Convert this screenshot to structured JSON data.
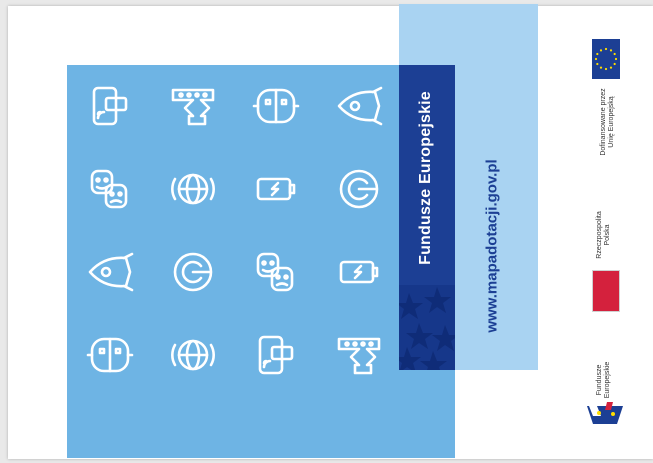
{
  "panel": {
    "title": "Fundusze Europejskie",
    "url": "www.mapadotacji.gov.pl"
  },
  "side": {
    "eu_label_line1": "Dofinansowane przez",
    "eu_label_line2": "Unię Europejską",
    "pl_label_line1": "Rzeczpospolita",
    "pl_label_line2": "Polska",
    "fe_label_line1": "Fundusze",
    "fe_label_line2": "Europejskie"
  },
  "icons": [
    [
      "phone-card-icon",
      "conveyor-icon",
      "robot-face-icon",
      "rocket-icon"
    ],
    [
      "faces-icon",
      "globe-icon",
      "battery-icon",
      "target-c-icon"
    ],
    [
      "rocket-icon",
      "target-c-icon",
      "faces-icon",
      "battery-icon"
    ],
    [
      "robot-face-icon",
      "globe-icon",
      "phone-card-icon",
      "conveyor-icon"
    ]
  ],
  "colors": {
    "square_blue": "#6eb4e4",
    "strip_light_blue": "#a9d3f2",
    "navy": "#1c3f94",
    "pl_red": "#d4213d",
    "eu_blue": "#1c3f94",
    "eu_star": "#ffde00"
  }
}
